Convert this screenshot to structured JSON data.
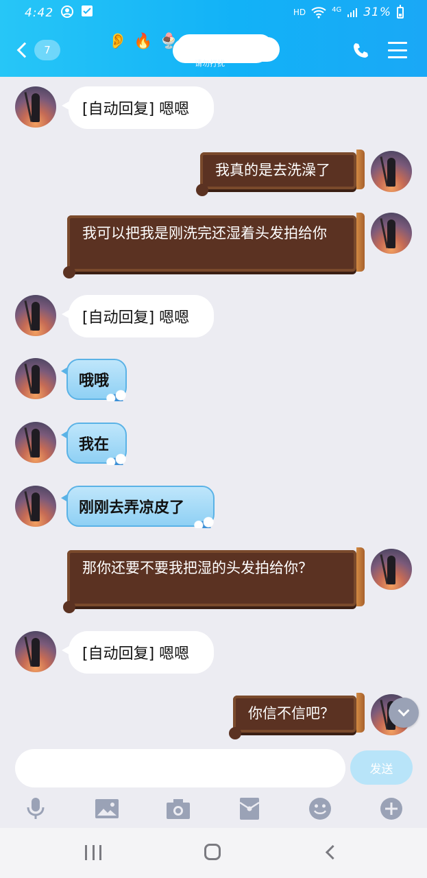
{
  "status_bar": {
    "time": "4:42",
    "network": "HD",
    "signal": "4G",
    "battery": "31%"
  },
  "header": {
    "unread_count": "7",
    "subtitle": "请勿打扰",
    "title_emoji": [
      "👂",
      "🔥",
      "🍨"
    ]
  },
  "messages": [
    {
      "side": "left",
      "style": "white",
      "text": "[自动回复] 嗯嗯"
    },
    {
      "side": "right",
      "style": "brown",
      "text": "我真的是去洗澡了"
    },
    {
      "side": "right",
      "style": "brown",
      "text": "我可以把我是刚洗完还湿着头发拍给你"
    },
    {
      "side": "left",
      "style": "white",
      "text": "[自动回复] 嗯嗯"
    },
    {
      "side": "left",
      "style": "blue",
      "text": "哦哦"
    },
    {
      "side": "left",
      "style": "blue",
      "text": "我在"
    },
    {
      "side": "left",
      "style": "blue",
      "text": "刚刚去弄凉皮了"
    },
    {
      "side": "right",
      "style": "brown",
      "text": "那你还要不要我把湿的头发拍给你？"
    },
    {
      "side": "left",
      "style": "white",
      "text": "[自动回复] 嗯嗯"
    },
    {
      "side": "right",
      "style": "brown",
      "text": "你信不信吧？"
    }
  ],
  "composer": {
    "input_value": "",
    "send_label": "发送"
  },
  "toolbar_icons": [
    "microphone-icon",
    "image-icon",
    "camera-icon",
    "red-packet-icon",
    "emoji-icon",
    "plus-icon"
  ],
  "colors": {
    "header": "#1ab4f7",
    "brown_bubble": "#5b3222",
    "blue_bubble": "#a6daf7",
    "send_button": "#b8e4f9"
  }
}
